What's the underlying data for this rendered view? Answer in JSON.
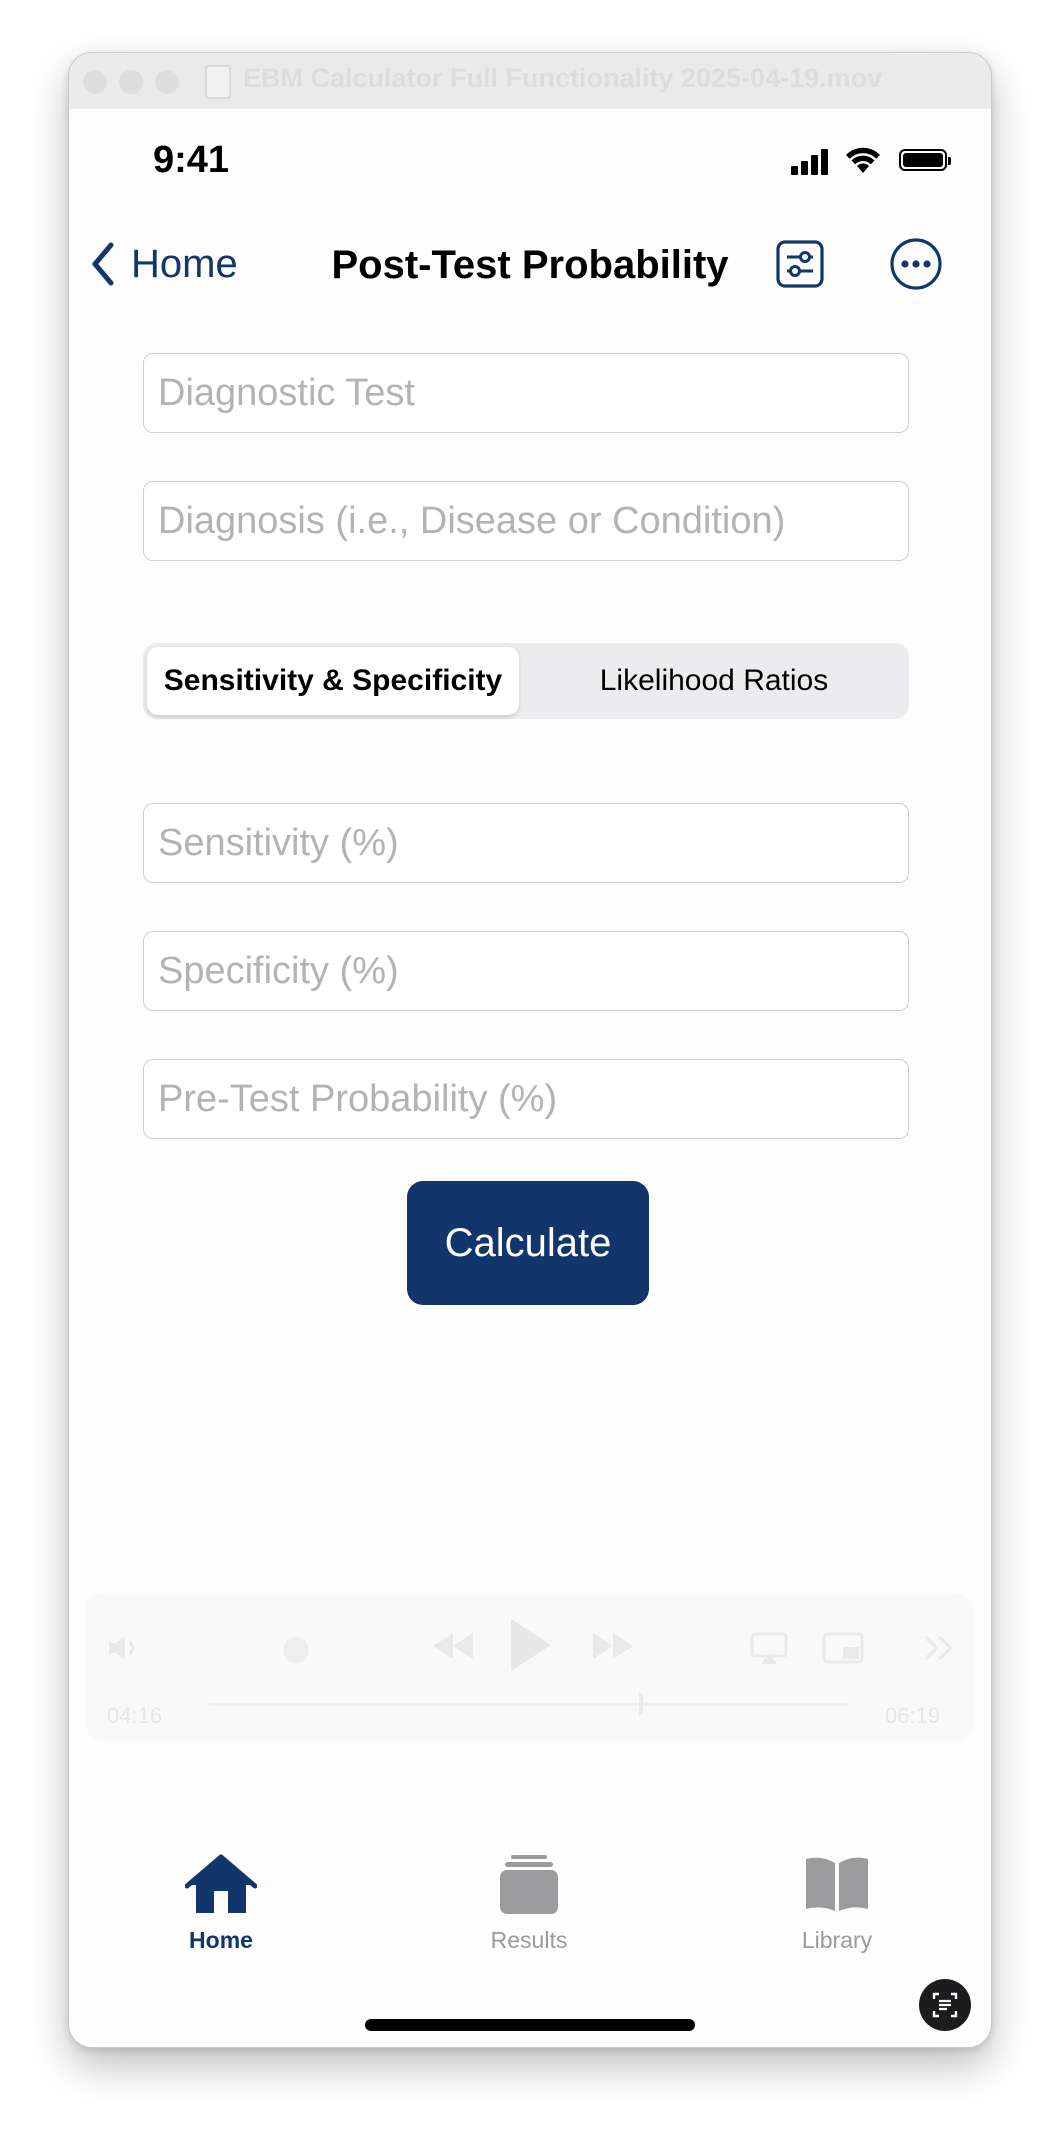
{
  "window": {
    "title": "EBM Calculator Full Functionality 2025-04-19.mov"
  },
  "status_bar": {
    "time": "9:41"
  },
  "nav": {
    "back_label": "Home",
    "title": "Post-Test Probability",
    "settings_icon": "sliders-icon",
    "more_icon": "ellipsis-circle-icon"
  },
  "fields": {
    "diagnostic_test": {
      "placeholder": "Diagnostic Test",
      "value": ""
    },
    "diagnosis": {
      "placeholder": "Diagnosis (i.e., Disease or Condition)",
      "value": ""
    },
    "sensitivity": {
      "placeholder": "Sensitivity (%)",
      "value": ""
    },
    "specificity": {
      "placeholder": "Specificity (%)",
      "value": ""
    },
    "pretest": {
      "placeholder": "Pre-Test Probability (%)",
      "value": ""
    }
  },
  "segmented": {
    "options": [
      "Sensitivity & Specificity",
      "Likelihood Ratios"
    ],
    "selected": "Sensitivity & Specificity"
  },
  "calculate_label": "Calculate",
  "player": {
    "elapsed": "04:16",
    "remaining": "06:19",
    "progress": 0.66
  },
  "tabs": [
    {
      "label": "Home",
      "icon": "house-icon",
      "selected": true
    },
    {
      "label": "Results",
      "icon": "stack-icon",
      "selected": false
    },
    {
      "label": "Library",
      "icon": "book-icon",
      "selected": false
    }
  ],
  "colors": {
    "accent": "#12366b",
    "inactive": "#9b9b9e",
    "placeholder": "#b3b3b3"
  }
}
